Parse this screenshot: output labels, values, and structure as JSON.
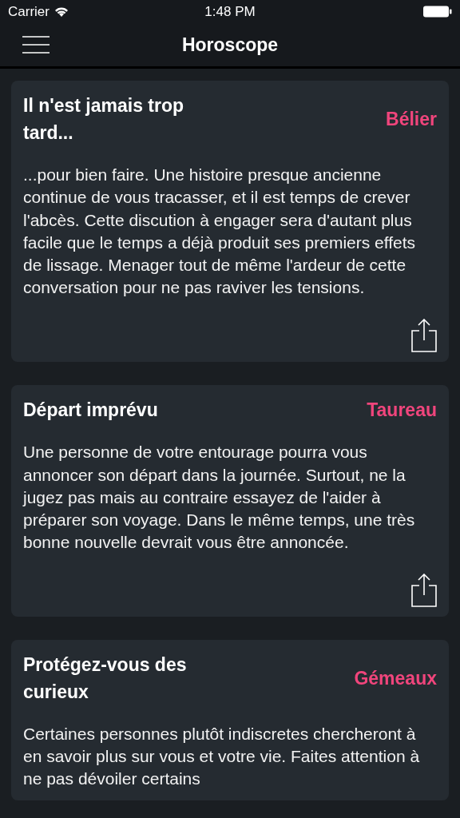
{
  "status_bar": {
    "carrier": "Carrier",
    "time": "1:48 PM"
  },
  "nav": {
    "title": "Horoscope"
  },
  "cards": [
    {
      "title": "Il n'est jamais trop tard...",
      "sign": "Bélier",
      "text": "...pour bien faire. Une histoire presque ancienne continue de vous tracasser, et il est temps de crever l'abcès. Cette discution à engager sera d'autant plus facile que le temps a déjà produit ses premiers effets de lissage. Menager tout de même l'ardeur de cette conversation pour ne pas raviver les tensions.",
      "share": true
    },
    {
      "title": "Départ imprévu",
      "sign": "Taureau",
      "text": "Une personne de votre entourage pourra vous annoncer son départ dans la journée. Surtout, ne la jugez pas mais au contraire essayez de l'aider à préparer son voyage. Dans le même temps, une très bonne nouvelle devrait vous être annoncée.",
      "share": true
    },
    {
      "title": "Protégez-vous des curieux",
      "sign": "Gémeaux",
      "text": "Certaines personnes plutôt indiscretes chercheront à en savoir plus sur vous et votre vie. Faites attention à ne pas dévoiler certains",
      "share": false
    }
  ]
}
